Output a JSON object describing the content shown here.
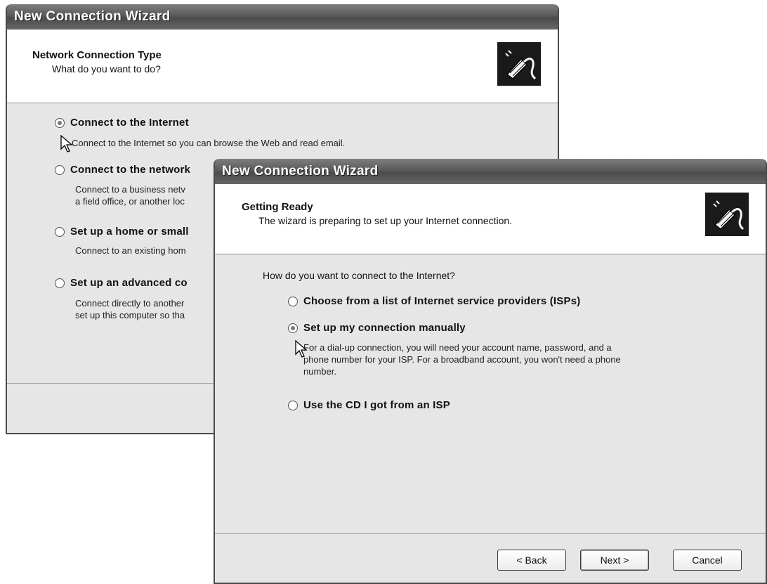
{
  "back_window": {
    "title": "New Connection Wizard",
    "header": {
      "title": "Network Connection Type",
      "subtitle": "What do you want to do?"
    },
    "options": [
      {
        "label": "Connect to the Internet",
        "checked": true,
        "description": [
          "Connect to the Internet so you can browse the Web and read email."
        ]
      },
      {
        "label": "Connect to the network",
        "checked": false,
        "description": [
          "Connect to a business netv",
          "a field office, or another loc"
        ]
      },
      {
        "label": "Set up a home or small",
        "checked": false,
        "description": [
          "Connect to an existing hom"
        ]
      },
      {
        "label": "Set up an advanced co",
        "checked": false,
        "description": [
          "Connect directly to another",
          "set up this computer so tha"
        ]
      }
    ]
  },
  "front_window": {
    "title": "New Connection Wizard",
    "header": {
      "title": "Getting Ready",
      "subtitle": "The wizard is preparing to set up your Internet connection."
    },
    "question": "How do you want to connect to the Internet?",
    "options": [
      {
        "label": "Choose from a list of Internet service providers (ISPs)",
        "checked": false
      },
      {
        "label": "Set up my connection manually",
        "checked": true,
        "description": [
          "For a dial-up connection, you will need your account name, password, and a",
          "phone number for your ISP. For a broadband account, you won't need a phone",
          "number."
        ]
      },
      {
        "label": "Use the CD I got from an ISP",
        "checked": false
      }
    ],
    "buttons": {
      "back": "< Back",
      "next": "Next >",
      "cancel": "Cancel"
    }
  },
  "icons": {
    "logo": "network-cable-icon",
    "cursor": "mouse-pointer-icon"
  }
}
